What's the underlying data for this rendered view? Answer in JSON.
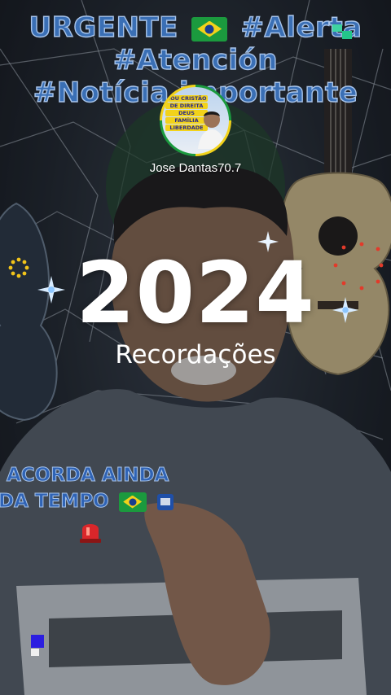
{
  "headline": {
    "line1_text": "URGENTE",
    "line1_tag": "#Alerta",
    "line2": "#Atención",
    "line3": "#Notícia importante"
  },
  "avatar": {
    "badge_lines": [
      "SOU CRISTÃO",
      "DE DIREITA",
      "DEUS",
      "FAMÍLIA",
      "LIBERDADE"
    ]
  },
  "username": "Jose Dantas70.7",
  "title": {
    "year": "2024",
    "subtitle": "Recordações"
  },
  "caption": {
    "line1": "ACORDA AINDA",
    "line2": "DA TEMPO"
  },
  "colors": {
    "hashtag_fill": "#3a6fb5",
    "hashtag_stroke": "#a8c4ea",
    "flag_green": "#1b9a3e",
    "flag_yellow": "#f2d21a",
    "flag_blue": "#183d8f"
  },
  "icons": [
    "brazil-flag-icon",
    "sparkle-icon",
    "siren-icon",
    "badge-icon",
    "gold-ring-icon"
  ]
}
